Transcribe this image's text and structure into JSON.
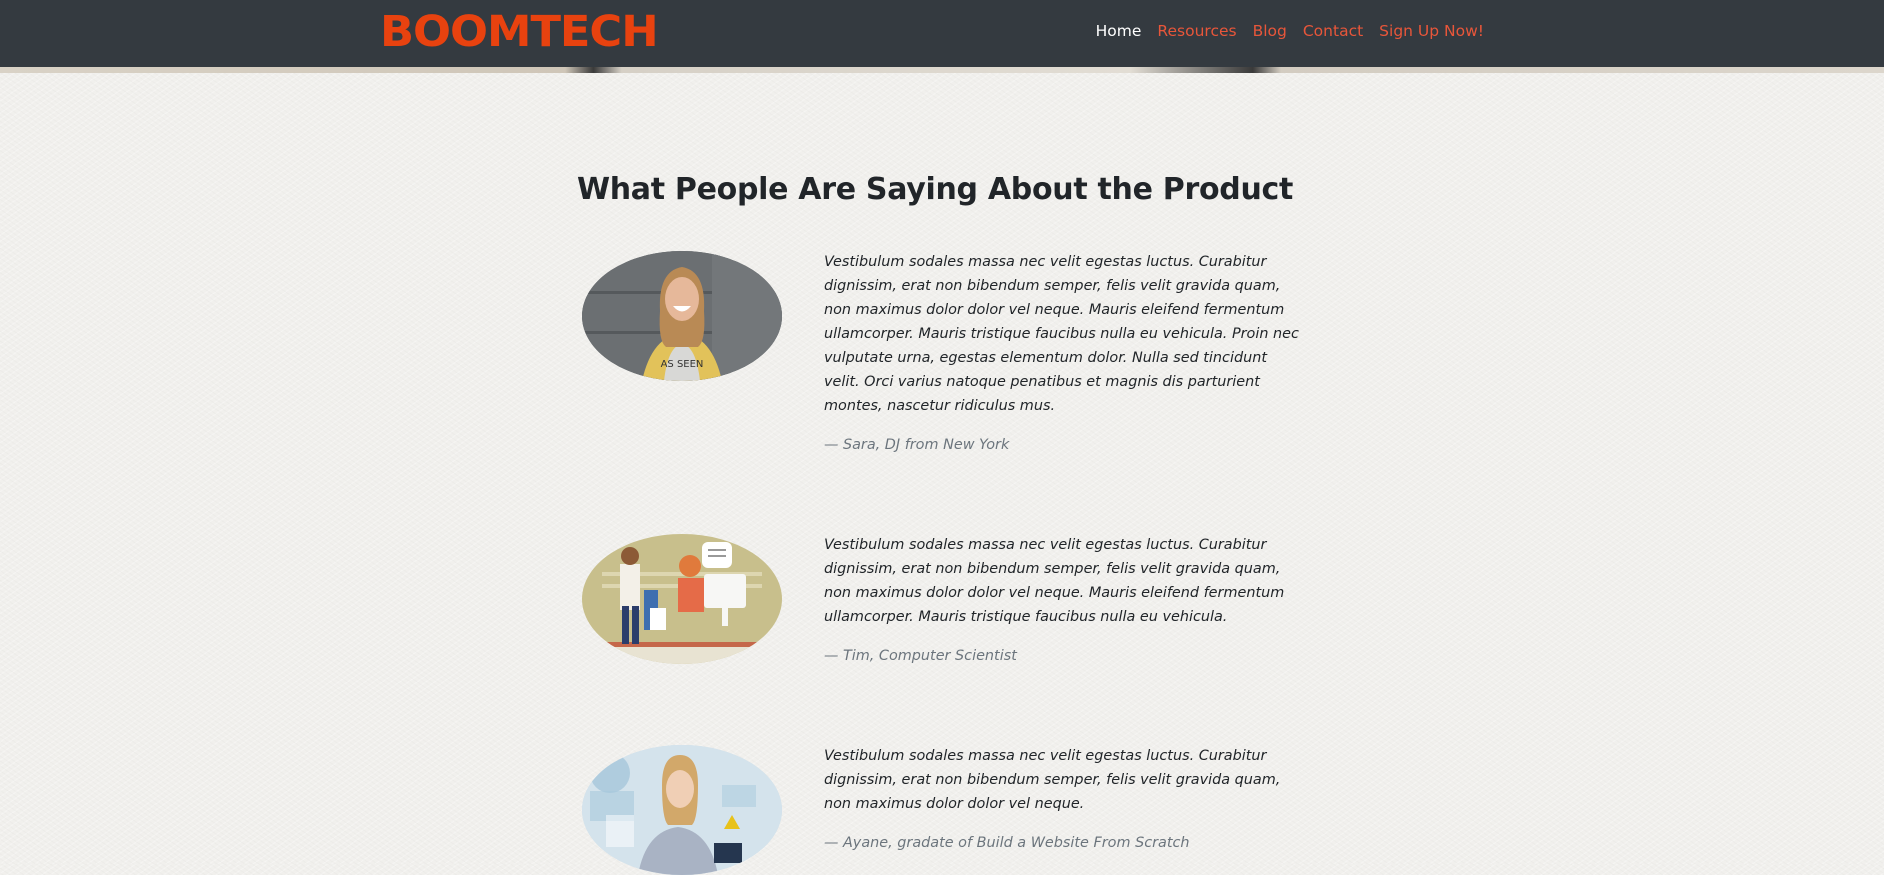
{
  "header": {
    "logo": "BOOMTECH",
    "nav": [
      {
        "label": "Home",
        "active": true
      },
      {
        "label": "Resources",
        "active": false
      },
      {
        "label": "Blog",
        "active": false
      },
      {
        "label": "Contact",
        "active": false
      },
      {
        "label": "Sign Up Now!",
        "active": false
      }
    ]
  },
  "main": {
    "title": "What People Are Saying About the Product",
    "testimonials": [
      {
        "text": "Vestibulum sodales massa nec velit egestas luctus. Curabitur dignissim, erat non bibendum semper, felis velit gravida quam, non maximus dolor dolor vel neque. Mauris eleifend fermentum ullamcorper. Mauris tristique faucibus nulla eu vehicula. Proin nec vulputate urna, egestas elementum dolor. Nulla sed tincidunt velit. Orci varius natoque penatibus et magnis dis parturient montes, nascetur ridiculus mus.",
        "author": "— Sara, DJ from New York"
      },
      {
        "text": "Vestibulum sodales massa nec velit egestas luctus. Curabitur dignissim, erat non bibendum semper, felis velit gravida quam, non maximus dolor dolor vel neque. Mauris eleifend fermentum ullamcorper. Mauris tristique faucibus nulla eu vehicula.",
        "author": "— Tim, Computer Scientist"
      },
      {
        "text": "Vestibulum sodales massa nec velit egestas luctus. Curabitur dignissim, erat non bibendum semper, felis velit gravida quam, non maximus dolor dolor vel neque.",
        "author": "— Ayane, gradate of Build a Website From Scratch"
      }
    ]
  },
  "colors": {
    "navbar_bg": "#343a40",
    "brand": "#e8420f",
    "nav_link": "#e8563a",
    "nav_active": "#ffffff",
    "page_bg": "#f1f0ed",
    "muted_text": "#6c757d"
  }
}
